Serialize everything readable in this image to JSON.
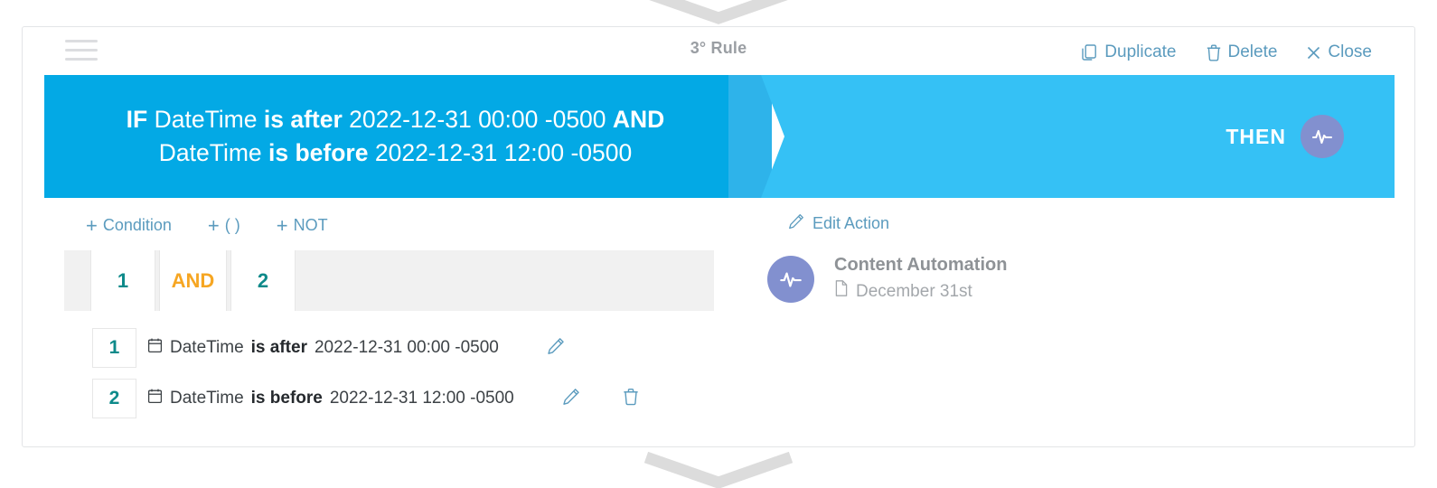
{
  "window": {
    "title": "3° Rule",
    "menu_icon": "hamburger-icon"
  },
  "header_actions": [
    {
      "label": "Duplicate",
      "icon": "copy-icon"
    },
    {
      "label": "Delete",
      "icon": "trash-icon"
    },
    {
      "label": "Close",
      "icon": "close-icon"
    }
  ],
  "banner": {
    "if_keyword": "IF",
    "and_keyword": "AND",
    "line1_field": "DateTime",
    "line1_operator": "is after",
    "line1_value": "2022-12-31 00:00 -0500",
    "line2_field": "DateTime",
    "line2_operator": "is before",
    "line2_value": "2022-12-31 12:00 -0500",
    "then_label": "THEN",
    "then_icon": "pulse-icon"
  },
  "condition_toolbar": [
    {
      "plus": "+",
      "label": "Condition"
    },
    {
      "plus": "+",
      "label": "( )"
    },
    {
      "plus": "+",
      "label": "NOT"
    }
  ],
  "expression": {
    "tokens": [
      {
        "text": "1",
        "kind": "number"
      },
      {
        "text": "AND",
        "kind": "operator"
      },
      {
        "text": "2",
        "kind": "number"
      }
    ]
  },
  "conditions": [
    {
      "number": "1",
      "icon": "calendar-icon",
      "field": "DateTime",
      "operator": "is after",
      "value": "2022-12-31 00:00 -0500",
      "edit_icon": "pencil-icon",
      "has_delete": false
    },
    {
      "number": "2",
      "icon": "calendar-icon",
      "field": "DateTime",
      "operator": "is before",
      "value": "2022-12-31 12:00 -0500",
      "edit_icon": "pencil-icon",
      "delete_icon": "trash-icon",
      "has_delete": true
    }
  ],
  "action": {
    "edit_label": "Edit Action",
    "edit_icon": "pencil-icon",
    "icon": "pulse-icon",
    "title": "Content Automation",
    "doc_icon": "document-icon",
    "subtitle": "December 31st"
  },
  "colors": {
    "if_blue": "#03a9e5",
    "then_blue": "#35c1f5",
    "accent_link": "#5b9bbe",
    "number_teal": "#0e8a8a",
    "operator_orange": "#f6a623",
    "action_purple": "#8290cf"
  }
}
